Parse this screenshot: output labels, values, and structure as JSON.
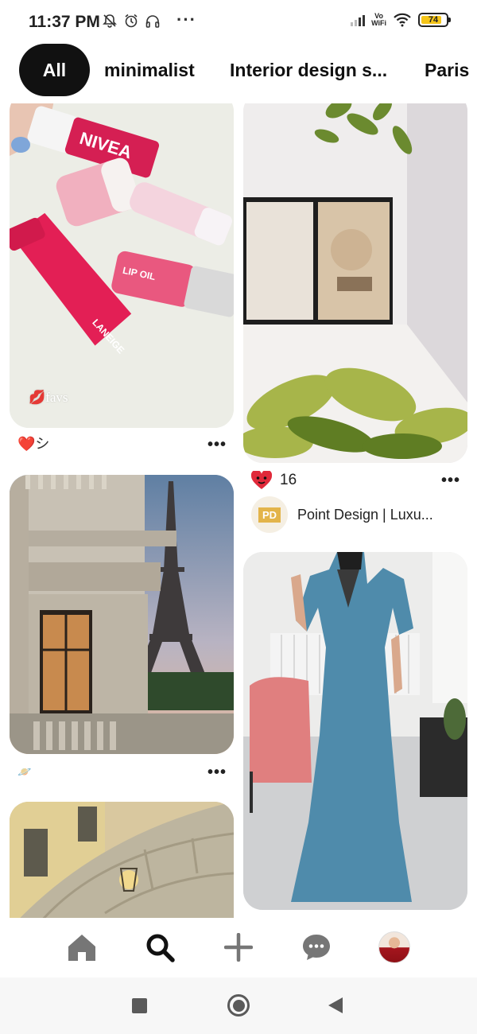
{
  "status_bar": {
    "time": "11:37 PM",
    "left_icons": [
      "mute-icon",
      "alarm-icon",
      "headphones-icon"
    ],
    "more": "···",
    "vowifi_top": "Vo",
    "vowifi_bottom": "WiFi",
    "battery_level": "74",
    "battery_color": "#f5c518"
  },
  "filters": [
    {
      "label": "All",
      "selected": true
    },
    {
      "label": "minimalist",
      "selected": false
    },
    {
      "label": "Interior design s...",
      "selected": false
    },
    {
      "label": "Paris",
      "selected": false
    }
  ],
  "pins": {
    "lip": {
      "overlay": "favs",
      "brand_text": "NIVEA",
      "product_text": "LIP OIL",
      "tube_text": "LANEIGE",
      "caption": "❤️シ",
      "more": "•••"
    },
    "interior": {
      "reaction_icon": "heart-eyes-icon",
      "reactions": "16",
      "source_logo": "PD",
      "source_name": "Point Design | Luxu...",
      "more": "•••"
    },
    "paris": {
      "caption": "🪐",
      "more": "•••"
    }
  },
  "bottom_nav": [
    {
      "name": "home",
      "active": false
    },
    {
      "name": "search",
      "active": true
    },
    {
      "name": "create",
      "active": false
    },
    {
      "name": "messages",
      "active": false
    },
    {
      "name": "profile",
      "active": false
    }
  ],
  "colors": {
    "accent": "#111111",
    "reaction": "#e0293a",
    "lip_pink": "#e0245e"
  }
}
